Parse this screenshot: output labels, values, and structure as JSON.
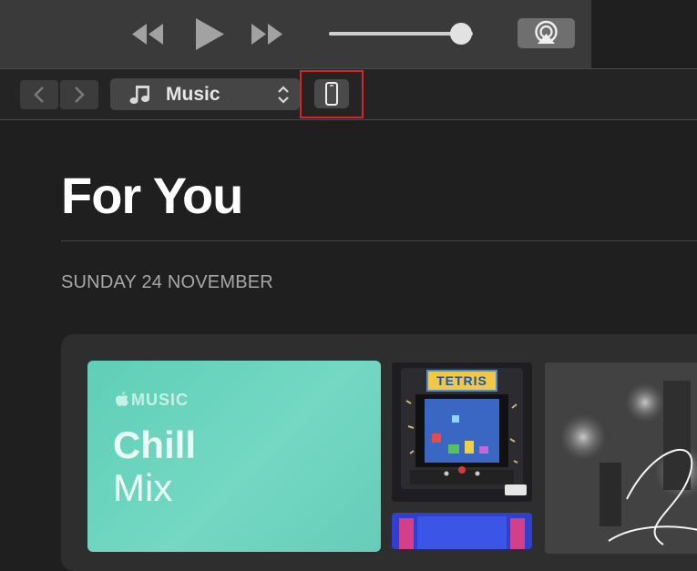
{
  "header": {
    "rewind_icon": "rewind-icon",
    "play_icon": "play-icon",
    "fast_forward_icon": "fast-forward-icon",
    "volume_level": 0.92,
    "airplay_icon": "airplay-icon"
  },
  "toolbar": {
    "back_icon": "chevron-left-icon",
    "forward_icon": "chevron-right-icon",
    "media_kind_icon": "music-note-icon",
    "media_kind": "Music",
    "media_chevron_icon": "up-down-chevron-icon",
    "device_icon": "iphone-icon"
  },
  "main": {
    "page_title": "For You",
    "date_label": "SUNDAY 24 NOVEMBER",
    "cards": [
      {
        "brand": "MUSIC",
        "title": "Chill",
        "subtitle": "Mix"
      }
    ],
    "albums": [
      {
        "icon": "arcade-album-art-icon",
        "label": "TETRIS"
      },
      {
        "icon": "night-city-album-art-icon"
      },
      {
        "icon": "blue-album-art-icon"
      }
    ]
  },
  "colors": {
    "accent": "#d62525",
    "chill_card": "#6ad4bf",
    "background": "#1f1f1f"
  }
}
